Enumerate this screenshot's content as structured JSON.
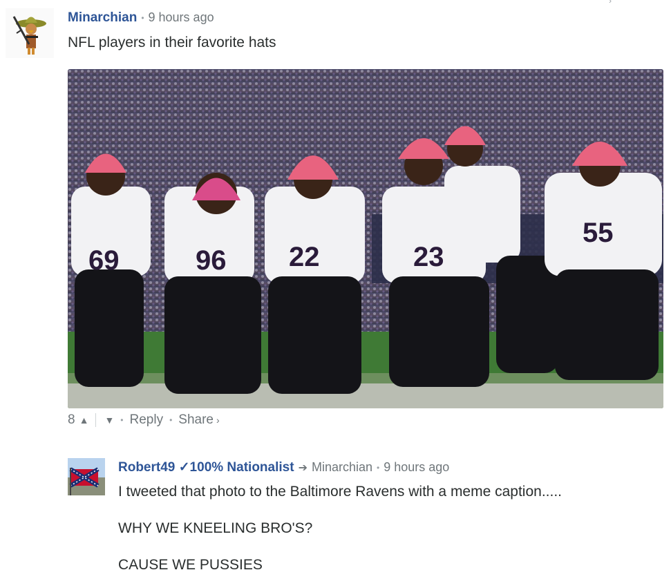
{
  "comment": {
    "author": "Minarchian",
    "time": "9 hours ago",
    "text": "NFL players in their favorite hats",
    "votes": "8",
    "upvote_icon": "chevron-up-icon",
    "downvote_icon": "chevron-down-icon",
    "reply_label": "Reply",
    "share_label": "Share",
    "share_icon": "chevron-right-icon"
  },
  "reply": {
    "author": "Robert49 ✓100% Nationalist",
    "parent_author": "Minarchian",
    "time": "9 hours ago",
    "lines": [
      "I tweeted that photo to the Baltimore Ravens with a meme caption.....",
      "WHY WE KNEELING BRO'S?",
      "CAUSE WE PUSSIES"
    ]
  },
  "colors": {
    "author_link": "#2e5597",
    "meta_text": "#6f767a",
    "body_text": "#2a2e2e",
    "hat_pink": "#e8637f",
    "jersey_white": "#f2f2f4",
    "turf_green": "#3f7a35"
  }
}
